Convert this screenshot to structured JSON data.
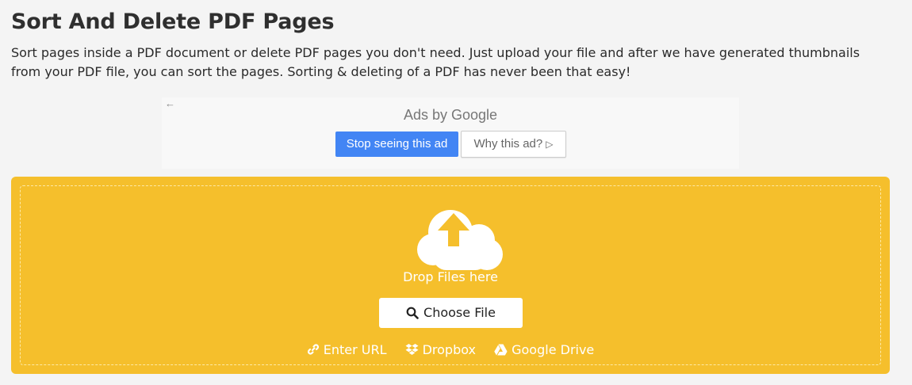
{
  "header": {
    "title": "Sort And Delete PDF Pages",
    "description": "Sort pages inside a PDF document or delete PDF pages you don't need. Just upload your file and after we have generated thumbnails from your PDF file, you can sort the pages. Sorting & deleting of a PDF has never been that easy!"
  },
  "ad": {
    "back_icon": "arrow-left-icon",
    "back_glyph": "←",
    "ads_by": "Ads by Google",
    "stop_label": "Stop seeing this ad",
    "why_label": "Why this ad?",
    "why_glyph": "▷",
    "accent_color": "#4285f4"
  },
  "upload": {
    "background_color": "#f5bf2c",
    "cloud_icon": "cloud-upload-icon",
    "drop_label": "Drop Files here",
    "choose_label": "Choose File",
    "choose_icon": "search-icon",
    "sources": [
      {
        "label": "Enter URL",
        "icon": "link-icon"
      },
      {
        "label": "Dropbox",
        "icon": "dropbox-icon"
      },
      {
        "label": "Google Drive",
        "icon": "google-drive-icon"
      }
    ]
  }
}
